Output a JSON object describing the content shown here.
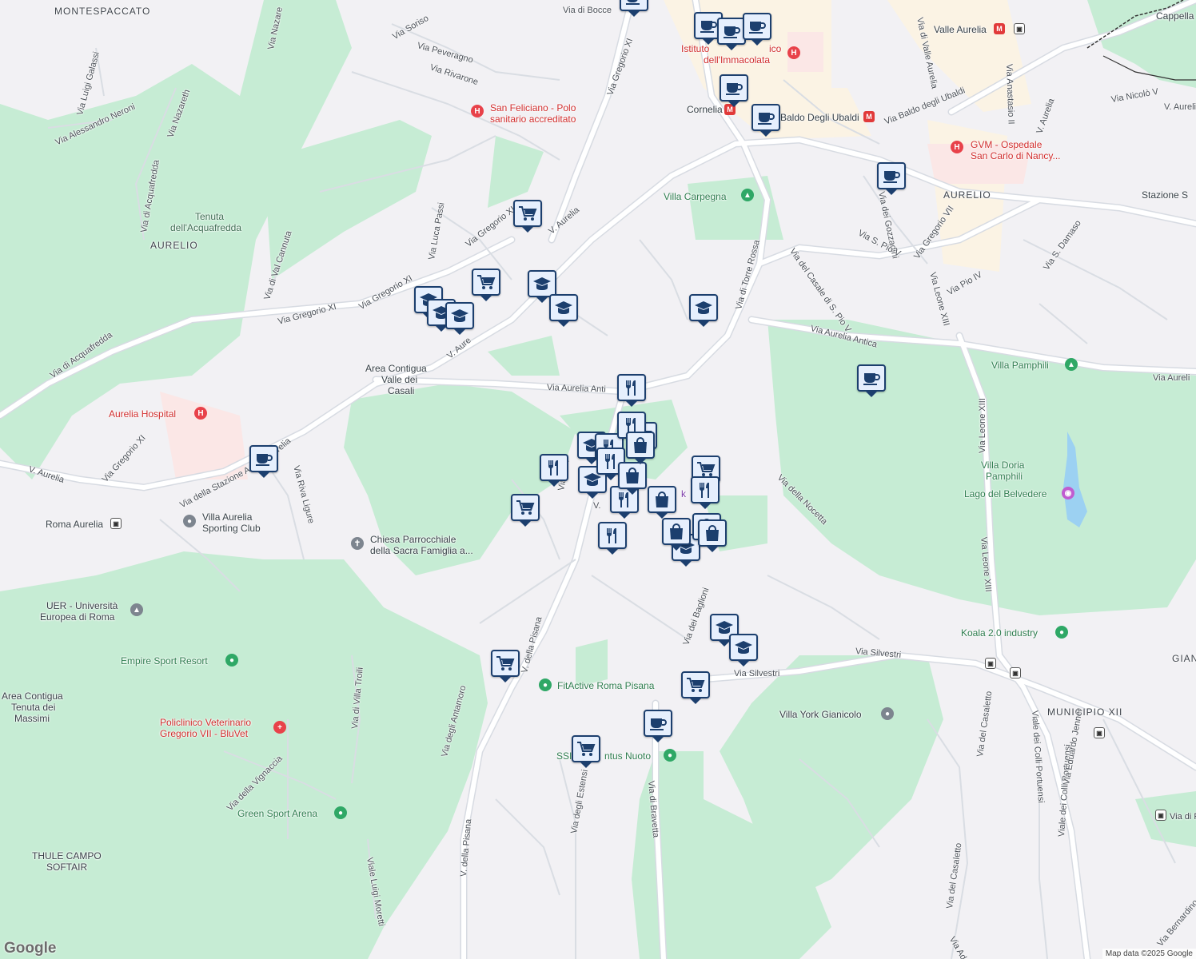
{
  "map": {
    "logo": "Google",
    "attribution": "Map data ©2025 Google"
  },
  "labels": {
    "montespaccato": "MONTESPACCATO",
    "aurelio_w": "AURELIO",
    "aurelio_e": "AURELIO",
    "municipio": "MUNICIPIO XII",
    "gian": "GIAN",
    "tenuta1": "Tenuta",
    "tenuta2": "dell'Acquafredda",
    "area_valle1": "Area Contigua",
    "area_valle2": "Valle dei",
    "area_valle3": "Casali",
    "area_massimi1": "Area Contigua",
    "area_massimi2": "Tenuta dei",
    "area_massimi3": "Massimi",
    "thule1": "THULE CAMPO",
    "thule2": "SOFTAIR",
    "villa_carpegna": "Villa Carpegna",
    "villa_pamphili": "Villa Pamphili",
    "villa_doria1": "Villa Doria",
    "villa_doria2": "Pamphili",
    "lago": "Lago del Belvedere",
    "koala": "Koala 2.0 industry",
    "villa_york": "Villa York Gianicolo",
    "fitactive": "FitActive Roma Pisana",
    "ssi": "SSI",
    "ntus": "ntus Nuoto",
    "empire": "Empire Sport Resort",
    "green_sport": "Green Sport Arena",
    "villa_aurelia1": "Villa Aurelia",
    "villa_aurelia2": "Sporting Club",
    "roma_aurelia": "Roma Aurelia",
    "chiesa1": "Chiesa Parrocchiale",
    "chiesa2": "della Sacra Famiglia a...",
    "uer1": "UER - Università",
    "uer2": "Europea di Roma",
    "policlinico1": "Policlinico Veterinario",
    "policlinico2": "Gregorio VII - BluVet",
    "aurelia_hospital": "Aurelia Hospital",
    "san_feliciano1": "San Feliciano - Polo",
    "san_feliciano2": "sanitario accreditato",
    "istituto1": "Istituto",
    "istituto2": "ico",
    "istituto3": "dell'Immacolata",
    "gvm1": "GVM - Ospedale",
    "gvm2": "San Carlo di Nancy...",
    "valle_aurelia": "Valle Aurelia",
    "cornelia": "Cornelia",
    "baldo_ubaldi_st": "Baldo Degli Ubaldi",
    "stazione_s": "Stazione S",
    "cappella": "Cappella",
    "park": "k",
    "via_di_bocce": "Via di Bocce",
    "via_soriso": "Via Soriso",
    "via_peveragno": "Via Peveragno",
    "via_rivarone": "Via Rivarone",
    "via_luigi_galassi": "Via Luigi Galassi",
    "via_alessandro_neroni": "Via Alessandro Neroni",
    "via_nazareth_top": "Via Nazare",
    "via_nazareth": "Via Nazareth",
    "via_di_acquafredda": "Via di Acquafredda",
    "via_di_acquafredda2": "Via di Acquafredda",
    "via_luca_passi": "Via Luca Passi",
    "via_gregorio_xi_a": "Via Gregorio XI",
    "via_gregorio_xi_b": "Via Gregorio XI",
    "via_gregorio_xi_c": "Via Gregorio XI",
    "via_gregorio_xi_d": "Via Gregorio XI",
    "via_gregorio_xi_e": "Via Gregorio XI",
    "via_di_val_cannuta": "Via di Val Cannuta",
    "v_aurelia_a": "V. Aurelia",
    "v_aurelia_b": "V. Aure",
    "v_aurelia_c": "V. Aurelia",
    "v_aurelia_d": "V. Aurelia",
    "v_aurelia_e": "V. Aurelia",
    "v_aurelia_f": "V. Aurelia",
    "via_aurelia_anti": "Via Aurelia Anti",
    "via_aurelia_antica": "Via Aurelia Antica",
    "via_aurelia_e": "Via Aureli",
    "via_di_torre_rossa": "Via di Torre Rossa",
    "via_casale_pio": "Via del Casale di S. Pio V",
    "via_baldo": "Via Baldo degli Ubaldi",
    "via_valle_aurelia": "Via di Valle Aurelia",
    "via_anastasio": "Via Anastasio II",
    "via_gozzadini": "Via dei Gozzadini",
    "via_s_pio_v": "Via S. Pio V",
    "via_gregorio_vii": "Via Gregorio VII",
    "via_pio_iv": "Via Pio IV",
    "via_s_damaso": "Via S. Damaso",
    "via_leone_xiii_a": "Via Leone XIII",
    "via_leone_xiii_b": "Via Leone XIII",
    "via_leone_xiii_c": "Via Leone XIII",
    "via_nicolo_v": "Via Nicolò V",
    "via_della_nocetta": "Via della Nocetta",
    "via_della_stazione_a": "Via della Stazione A",
    "via_riva_ligure": "Via Riva Ligure",
    "via_della_pisana": "V. della Pisana",
    "via_della_pisana2": "V. della Pisana",
    "via_dei_baglioni": "Via dei Baglioni",
    "via_silvestri_a": "Via Silvestri",
    "via_silvestri_b": "Via Silvestri",
    "via_degli_antamoro": "Via degli Antamoro",
    "via_di_villa_troili": "Via di Villa Troili",
    "via_della_vignaccia": "Via della Vignaccia",
    "via_luigi_moretti": "Viale Luigi Moretti",
    "via_degli_estensi": "Via degli Estensi",
    "via_di_bravetta": "Via di Bravetta",
    "via_del_casaletto": "Via del Casaletto",
    "via_del_casaletto2": "Via del Casaletto",
    "viale_colli_portuensi": "Viale dei Colli Portuensi",
    "viale_colli_portuensi2": "Viale dei Colli Portuensi",
    "via_eduardo_jenner": "Via Eduardo Jenner",
    "via_adolfo": "Via Adolfo",
    "via_bernardino": "Via Bernardino",
    "via_di_pa": "Via di Pa",
    "via_di_f": "Via del F",
    "via_v": "V."
  },
  "colors": {
    "background": "#f2f1f4",
    "park": "#c6ecd4",
    "road": "#ffffff",
    "road_outline": "#d7dbe2",
    "pin_fill": "#e6effd",
    "pin_border": "#1c3f6e",
    "hospital": "#e8424a",
    "poi_green": "#2fa866"
  },
  "pins": [
    {
      "type": "cafe"
    },
    {
      "type": "cafe"
    },
    {
      "type": "cafe"
    },
    {
      "type": "cafe"
    },
    {
      "type": "cafe"
    },
    {
      "type": "cafe"
    },
    {
      "type": "cafe"
    },
    {
      "type": "cafe"
    },
    {
      "type": "cafe"
    },
    {
      "type": "cafe"
    },
    {
      "type": "grocery"
    },
    {
      "type": "grocery"
    },
    {
      "type": "grocery"
    },
    {
      "type": "grocery"
    },
    {
      "type": "grocery"
    },
    {
      "type": "grocery"
    },
    {
      "type": "grocery"
    },
    {
      "type": "grocery"
    },
    {
      "type": "school"
    },
    {
      "type": "school"
    },
    {
      "type": "school"
    },
    {
      "type": "school"
    },
    {
      "type": "school"
    },
    {
      "type": "school"
    },
    {
      "type": "school"
    },
    {
      "type": "school"
    },
    {
      "type": "school"
    },
    {
      "type": "school"
    },
    {
      "type": "school"
    },
    {
      "type": "restaurant"
    },
    {
      "type": "restaurant"
    },
    {
      "type": "restaurant"
    },
    {
      "type": "restaurant"
    },
    {
      "type": "restaurant"
    },
    {
      "type": "restaurant"
    },
    {
      "type": "restaurant"
    },
    {
      "type": "restaurant"
    },
    {
      "type": "shopping"
    },
    {
      "type": "shopping"
    },
    {
      "type": "shopping"
    },
    {
      "type": "shopping"
    },
    {
      "type": "shopping"
    },
    {
      "type": "shopping"
    },
    {
      "type": "shopping"
    }
  ]
}
